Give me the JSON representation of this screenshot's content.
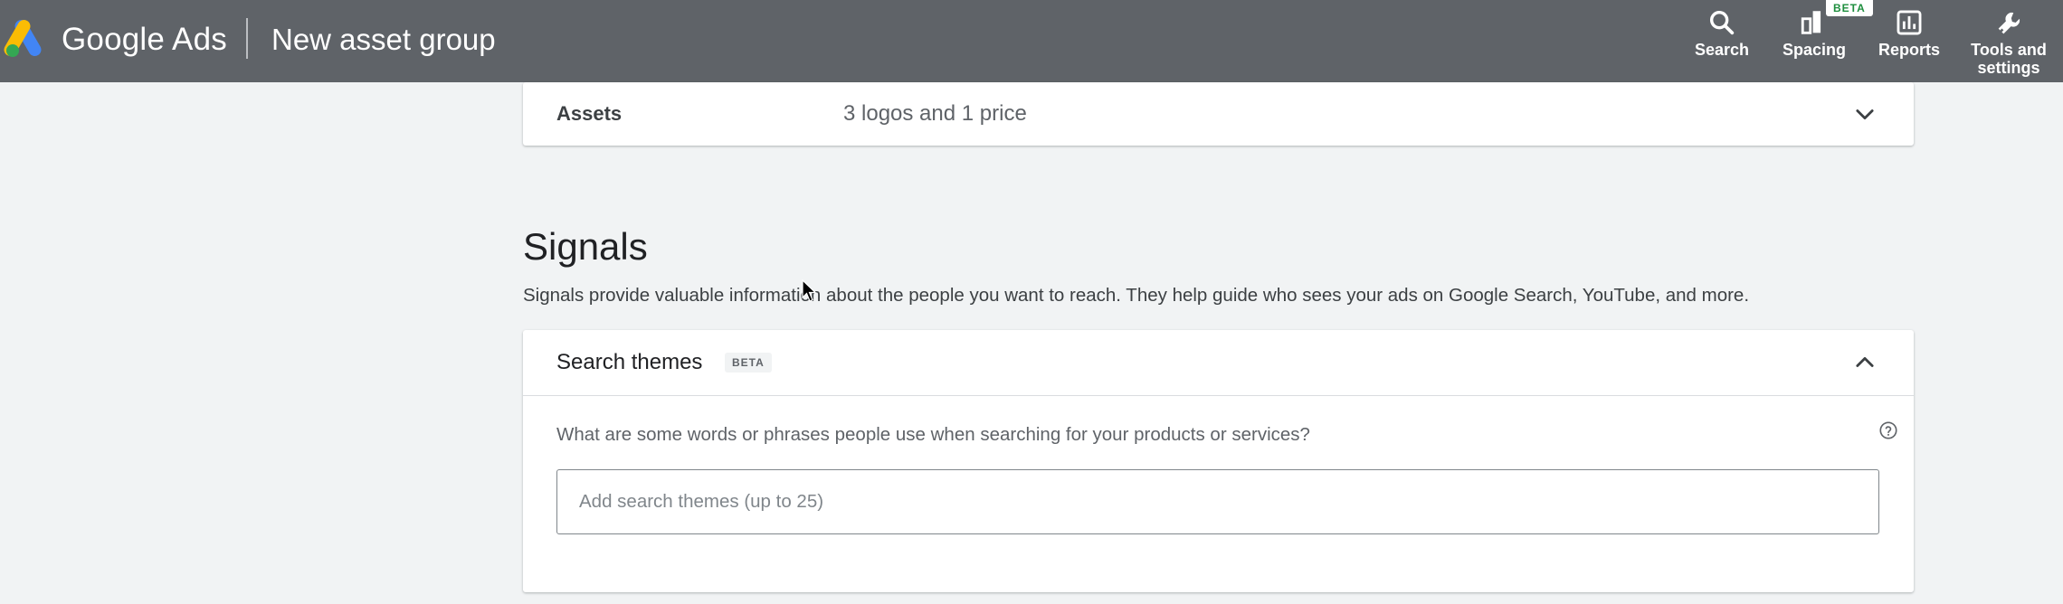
{
  "topbar": {
    "brand": "Google Ads",
    "page_name": "New asset group",
    "tools": [
      {
        "label": "Search",
        "icon": "search-icon"
      },
      {
        "label": "Spacing",
        "icon": "spacing-icon",
        "badge": "BETA"
      },
      {
        "label": "Reports",
        "icon": "reports-icon"
      },
      {
        "label": "Tools and settings",
        "icon": "wrench-icon"
      }
    ]
  },
  "assets": {
    "label": "Assets",
    "summary": "3 logos and 1 price"
  },
  "signals": {
    "title": "Signals",
    "description": "Signals provide valuable information about the people you want to reach. They help guide who sees your ads on Google Search, YouTube, and more."
  },
  "search_themes": {
    "title": "Search themes",
    "badge": "BETA",
    "question": "What are some words or phrases people use when searching for your products or services?",
    "input_placeholder": "Add search themes (up to 25)",
    "input_value": ""
  },
  "colors": {
    "topbar": "#5f6368",
    "background": "#f1f3f4",
    "logo_blue": "#4285f4",
    "logo_yellow": "#fbbc04",
    "logo_green": "#34a853"
  }
}
